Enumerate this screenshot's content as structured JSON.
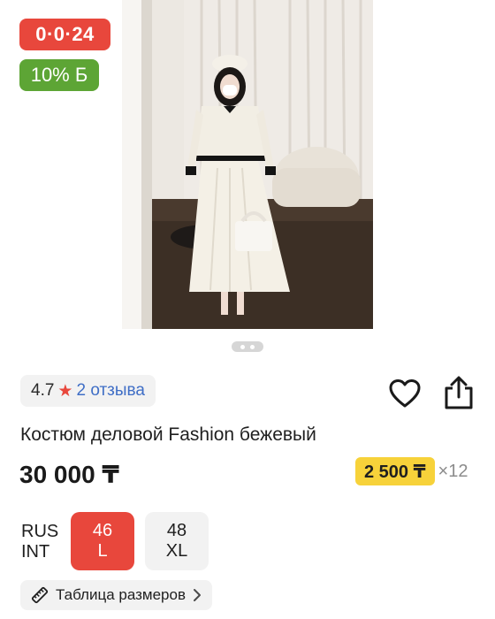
{
  "badges": {
    "installment": "0·0·24",
    "bonus": "10% Б"
  },
  "gallery": {
    "dots": 2,
    "active_index": 1
  },
  "rating": {
    "value": "4.7",
    "reviews": "2 отзыва"
  },
  "product": {
    "title": "Костюм деловой Fashion бежевый",
    "price": "30 000 ₸",
    "monthly_payment": "2 500 ₸",
    "months": "×12"
  },
  "sizes": {
    "system_labels": [
      "RUS",
      "INT"
    ],
    "options": [
      {
        "rus": "46",
        "int": "L",
        "selected": true
      },
      {
        "rus": "48",
        "int": "XL",
        "selected": false
      }
    ]
  },
  "size_table": {
    "label": "Таблица размеров"
  },
  "colors": {
    "accent_red": "#e8473c",
    "bonus_green": "#5da535",
    "monthly_yellow": "#f7d23a",
    "link_blue": "#3f6ec6"
  },
  "icons": [
    "star-icon",
    "heart-icon",
    "share-icon",
    "ruler-icon",
    "chevron-right-icon"
  ]
}
